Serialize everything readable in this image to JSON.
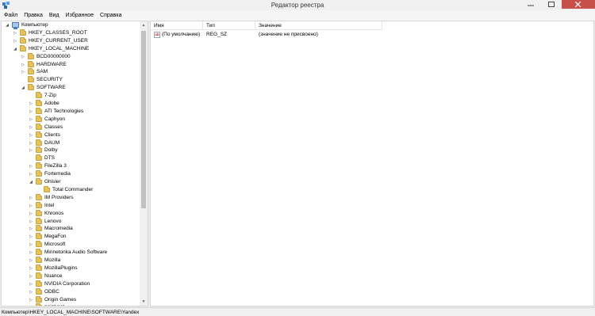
{
  "window": {
    "title": "Редактор реестра",
    "close_color": "#c7504a"
  },
  "menu": [
    "Файл",
    "Правка",
    "Вид",
    "Избранное",
    "Справка"
  ],
  "tree": {
    "root": "Компьютер",
    "items": [
      {
        "label": "HKEY_CLASSES_ROOT",
        "depth": 1,
        "expander": "collapsed"
      },
      {
        "label": "HKEY_CURRENT_USER",
        "depth": 1,
        "expander": "collapsed"
      },
      {
        "label": "HKEY_LOCAL_MACHINE",
        "depth": 1,
        "expander": "expanded"
      },
      {
        "label": "BCD00000000",
        "depth": 2,
        "expander": "collapsed"
      },
      {
        "label": "HARDWARE",
        "depth": 2,
        "expander": "collapsed"
      },
      {
        "label": "SAM",
        "depth": 2,
        "expander": "collapsed"
      },
      {
        "label": "SECURITY",
        "depth": 2,
        "expander": "none"
      },
      {
        "label": "SOFTWARE",
        "depth": 2,
        "expander": "expanded"
      },
      {
        "label": "7-Zip",
        "depth": 3,
        "expander": "none"
      },
      {
        "label": "Adobe",
        "depth": 3,
        "expander": "collapsed"
      },
      {
        "label": "ATI Technologies",
        "depth": 3,
        "expander": "collapsed"
      },
      {
        "label": "Caphyon",
        "depth": 3,
        "expander": "collapsed"
      },
      {
        "label": "Classes",
        "depth": 3,
        "expander": "collapsed"
      },
      {
        "label": "Clients",
        "depth": 3,
        "expander": "collapsed"
      },
      {
        "label": "DAUM",
        "depth": 3,
        "expander": "collapsed"
      },
      {
        "label": "Dolby",
        "depth": 3,
        "expander": "collapsed"
      },
      {
        "label": "DTS",
        "depth": 3,
        "expander": "none"
      },
      {
        "label": "FileZilla 3",
        "depth": 3,
        "expander": "collapsed"
      },
      {
        "label": "Fortemedia",
        "depth": 3,
        "expander": "collapsed"
      },
      {
        "label": "Ghisler",
        "depth": 3,
        "expander": "expanded"
      },
      {
        "label": "Total Commander",
        "depth": 4,
        "expander": "none"
      },
      {
        "label": "IM Providers",
        "depth": 3,
        "expander": "collapsed"
      },
      {
        "label": "Intel",
        "depth": 3,
        "expander": "collapsed"
      },
      {
        "label": "Khronos",
        "depth": 3,
        "expander": "collapsed"
      },
      {
        "label": "Lenovo",
        "depth": 3,
        "expander": "collapsed"
      },
      {
        "label": "Macromedia",
        "depth": 3,
        "expander": "collapsed"
      },
      {
        "label": "MegaFon",
        "depth": 3,
        "expander": "collapsed"
      },
      {
        "label": "Microsoft",
        "depth": 3,
        "expander": "collapsed"
      },
      {
        "label": "Minnetonka Audio Software",
        "depth": 3,
        "expander": "collapsed"
      },
      {
        "label": "Mozilla",
        "depth": 3,
        "expander": "collapsed"
      },
      {
        "label": "MozillaPlugins",
        "depth": 3,
        "expander": "collapsed"
      },
      {
        "label": "Nuance",
        "depth": 3,
        "expander": "collapsed"
      },
      {
        "label": "NVIDIA Corporation",
        "depth": 3,
        "expander": "collapsed"
      },
      {
        "label": "ODBC",
        "depth": 3,
        "expander": "collapsed"
      },
      {
        "label": "Origin Games",
        "depth": 3,
        "expander": "collapsed"
      },
      {
        "label": "paint.net",
        "depth": 3,
        "expander": "collapsed"
      }
    ]
  },
  "values": {
    "columns": [
      "Имя",
      "Тип",
      "Значение"
    ],
    "rows": [
      {
        "name": "(По умолчанию)",
        "type": "REG_SZ",
        "data": "(значение не присвоено)",
        "icon": "string-value-icon"
      }
    ]
  },
  "status": "Компьютер\\HKEY_LOCAL_MACHINE\\SOFTWARE\\Yandex"
}
